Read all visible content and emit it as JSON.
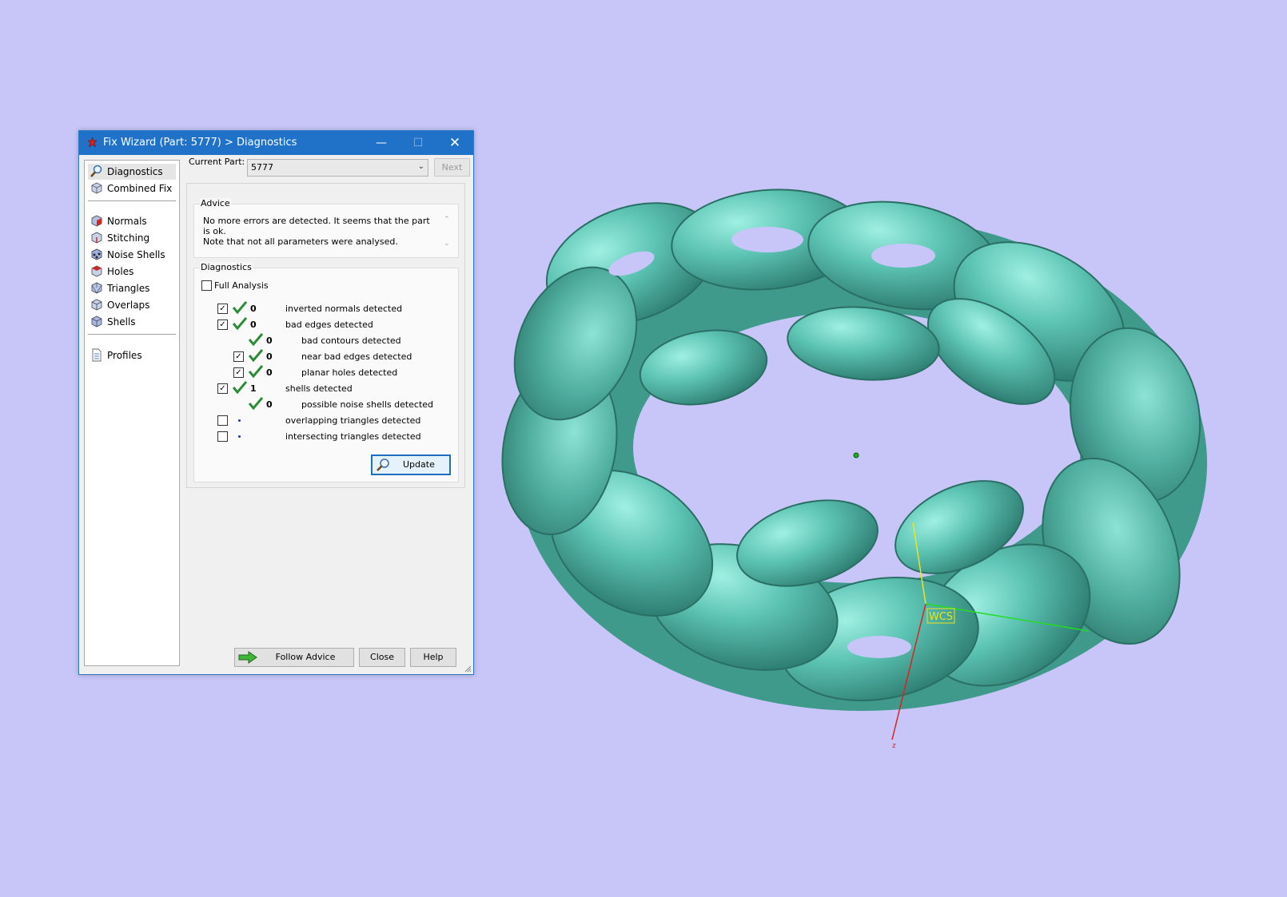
{
  "window": {
    "title": "Fix Wizard (Part: 5777) > Diagnostics",
    "controls": {
      "minimize": "—",
      "maximize": "☐",
      "close": "✕"
    }
  },
  "sidebar": {
    "items": [
      {
        "label": "Diagnostics",
        "icon": "magnifier-icon",
        "active": true
      },
      {
        "label": "Combined Fix",
        "icon": "cube-icon"
      },
      {
        "label": "Normals",
        "icon": "normals-cube-icon"
      },
      {
        "label": "Stitching",
        "icon": "stitching-cube-icon"
      },
      {
        "label": "Noise Shells",
        "icon": "noise-shells-icon"
      },
      {
        "label": "Holes",
        "icon": "holes-cube-icon"
      },
      {
        "label": "Triangles",
        "icon": "triangles-cube-icon"
      },
      {
        "label": "Overlaps",
        "icon": "overlaps-cube-icon"
      },
      {
        "label": "Shells",
        "icon": "shells-cube-icon"
      },
      {
        "label": "Profiles",
        "icon": "document-icon"
      }
    ]
  },
  "current_part": {
    "label": "Current Part:",
    "value": "5777",
    "next": "Next"
  },
  "advice": {
    "title": "Advice",
    "line1": "No more errors are detected. It seems that the part is ok.",
    "line2": "Note that not all parameters were analysed."
  },
  "diagnostics": {
    "title": "Diagnostics",
    "full_analysis": {
      "label": "Full Analysis",
      "checked": false
    },
    "rows": [
      {
        "checkbox": "checked",
        "status": "ok",
        "count": "0",
        "text": "inverted normals detected",
        "indent": 0
      },
      {
        "checkbox": "checked",
        "status": "ok",
        "count": "0",
        "text": "bad edges detected",
        "indent": 0
      },
      {
        "checkbox": "none",
        "status": "ok",
        "count": "0",
        "text": "bad contours detected",
        "indent": 1
      },
      {
        "checkbox": "checked",
        "status": "ok",
        "count": "0",
        "text": "near bad edges detected",
        "indent": 1
      },
      {
        "checkbox": "checked",
        "status": "ok",
        "count": "0",
        "text": "planar holes detected",
        "indent": 1
      },
      {
        "checkbox": "checked",
        "status": "ok",
        "count": "1",
        "text": "shells detected",
        "indent": 0
      },
      {
        "checkbox": "none",
        "status": "ok",
        "count": "0",
        "text": "possible noise shells detected",
        "indent": 1
      },
      {
        "checkbox": "unchecked",
        "status": "pending",
        "count": "",
        "text": "overlapping triangles detected",
        "indent": 0
      },
      {
        "checkbox": "unchecked",
        "status": "pending",
        "count": "",
        "text": "intersecting triangles detected",
        "indent": 0
      }
    ],
    "update": "Update"
  },
  "footer": {
    "follow_advice": "Follow Advice",
    "close": "Close",
    "help": "Help"
  },
  "viewport": {
    "axis_label": "WCS",
    "z_label": "z",
    "model_color": "#5fc4b4",
    "background": "#c8c6f8"
  },
  "colors": {
    "titlebar": "#1f72c7",
    "check": "#2f8a3a",
    "x_axis": "#22dd22",
    "y_axis": "#e6e622",
    "z_axis": "#dd2222"
  }
}
